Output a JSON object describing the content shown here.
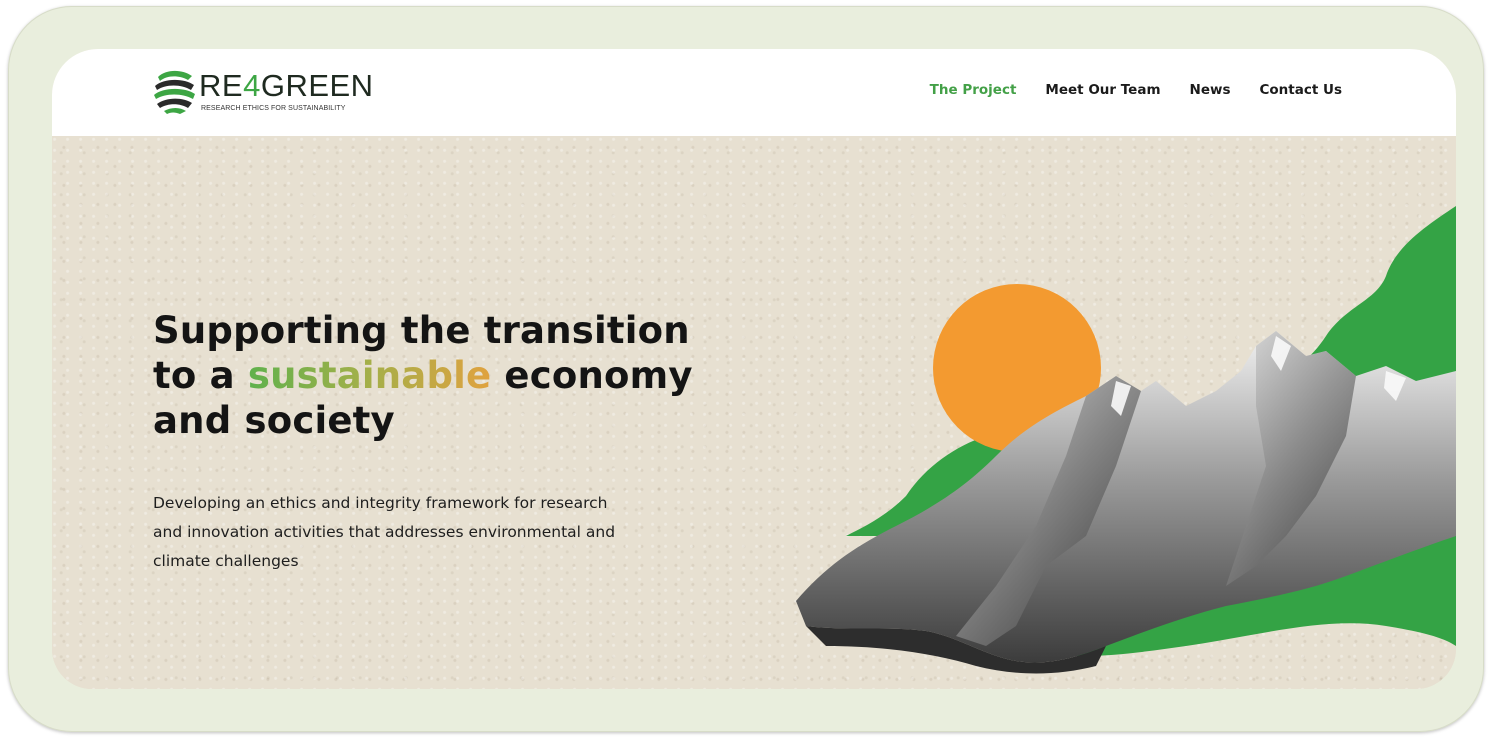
{
  "logo": {
    "word_prefix": "RE",
    "word_accent": "4",
    "word_suffix": "GREEN",
    "tagline": "RESEARCH ETHICS FOR SUSTAINABILITY"
  },
  "nav": {
    "items": [
      {
        "label": "The Project",
        "active": true
      },
      {
        "label": "Meet Our Team",
        "active": false
      },
      {
        "label": "News",
        "active": false
      },
      {
        "label": "Contact Us",
        "active": false
      }
    ]
  },
  "hero": {
    "headline_line1": "Supporting the transition",
    "headline_line2_pre": "to a ",
    "headline_highlight": "sustainable",
    "headline_line2_post": " economy",
    "headline_line3": "and society",
    "subtext": "Developing an ethics and integrity framework for research and innovation activities that addresses environmental and climate challenges"
  },
  "colors": {
    "accent_green": "#43a047",
    "art_green": "#34a345",
    "sun_orange": "#f39a30",
    "paper": "#e7e0d1",
    "frame": "#e9eedd"
  },
  "icons": {
    "logo_mark": "globe-leaf-icon"
  }
}
